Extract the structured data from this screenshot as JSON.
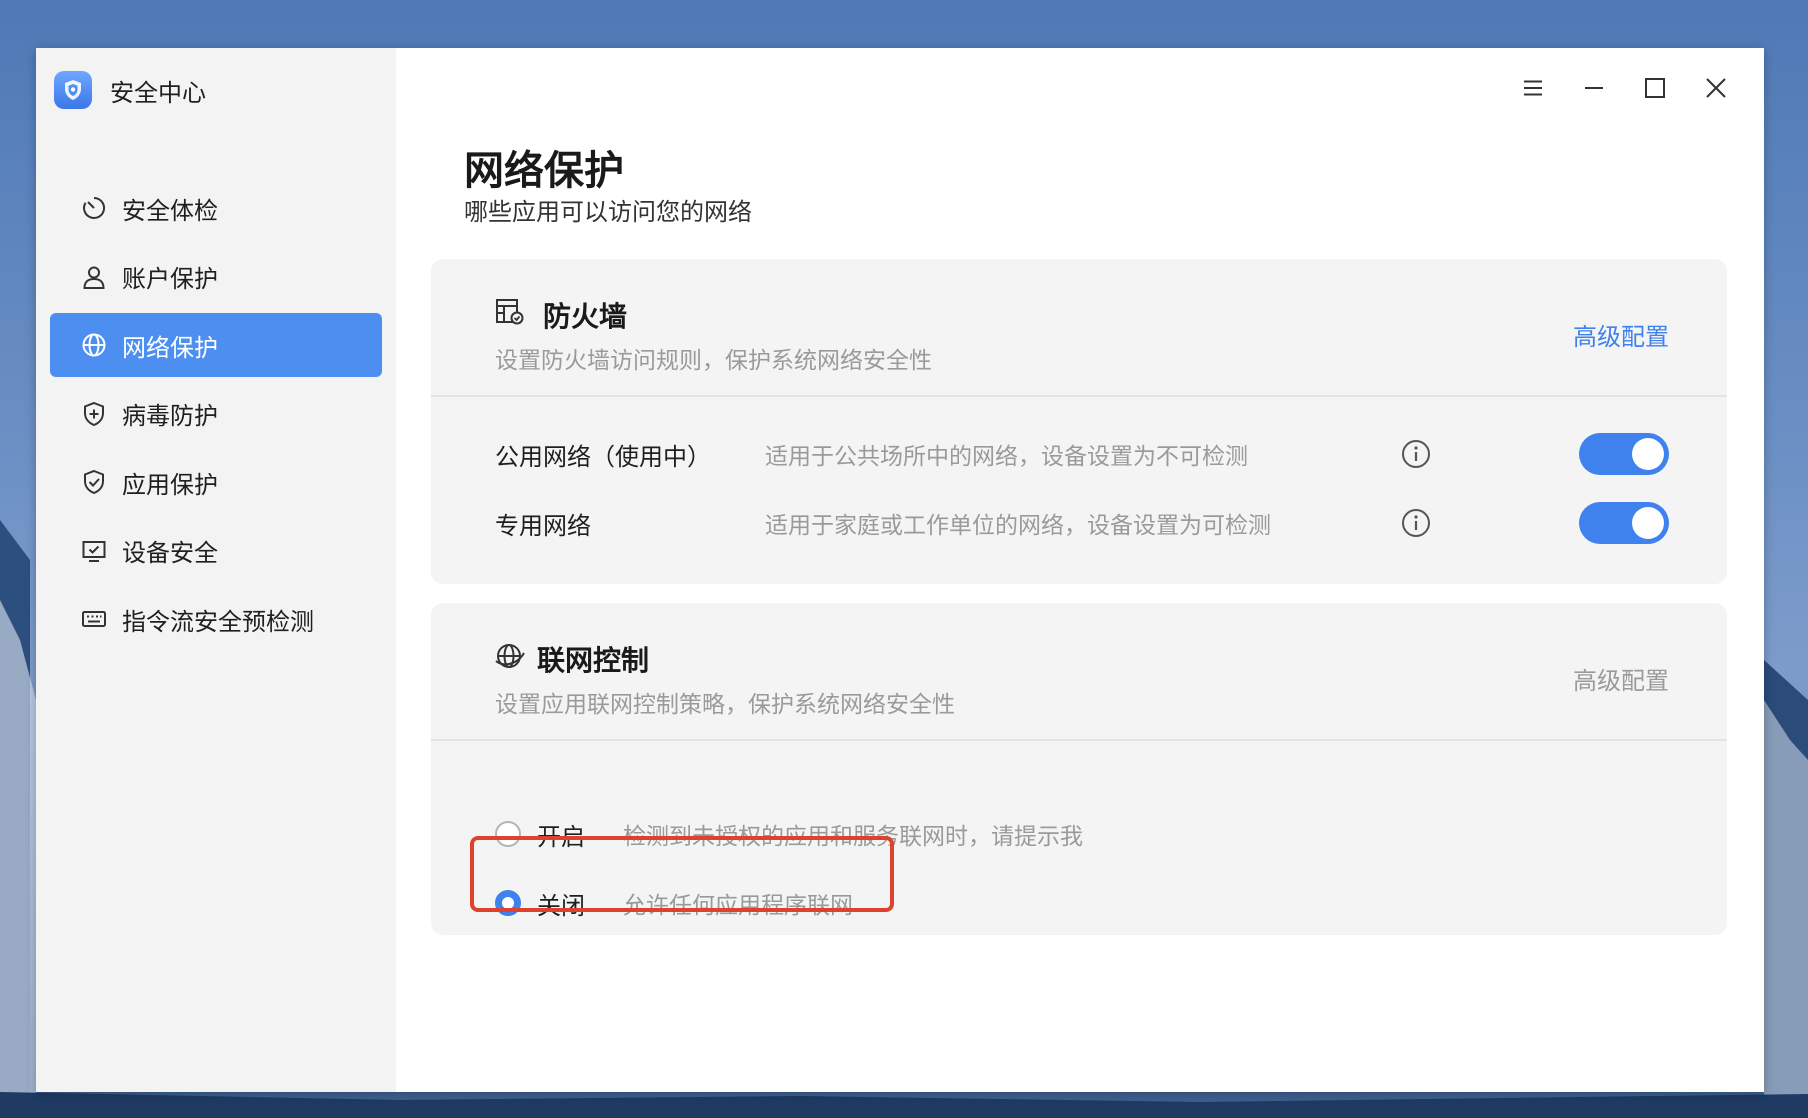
{
  "app": {
    "title": "安全中心"
  },
  "sidebar": {
    "items": [
      {
        "label": "安全体检",
        "icon": "scan-icon",
        "active": false
      },
      {
        "label": "账户保护",
        "icon": "user-icon",
        "active": false
      },
      {
        "label": "网络保护",
        "icon": "globe-icon",
        "active": true
      },
      {
        "label": "病毒防护",
        "icon": "shield-plus-icon",
        "active": false
      },
      {
        "label": "应用保护",
        "icon": "shield-check-icon",
        "active": false
      },
      {
        "label": "设备安全",
        "icon": "monitor-check-icon",
        "active": false
      },
      {
        "label": "指令流安全预检测",
        "icon": "keyboard-icon",
        "active": false
      }
    ]
  },
  "window_controls": [
    "menu-icon",
    "minimize-icon",
    "maximize-icon",
    "close-icon"
  ],
  "page": {
    "title": "网络保护",
    "subtitle": "哪些应用可以访问您的网络"
  },
  "firewall": {
    "title": "防火墙",
    "description": "设置防火墙访问规则，保护系统网络安全性",
    "advanced_label": "高级配置",
    "advanced_color": "#3f82ee",
    "networks": [
      {
        "label": "公用网络（使用中）",
        "description": "适用于公共场所中的网络，设备设置为不可检测",
        "enabled": true
      },
      {
        "label": "专用网络",
        "description": "适用于家庭或工作单位的网络，设备设置为可检测",
        "enabled": true
      }
    ]
  },
  "network_control": {
    "title": "联网控制",
    "description": "设置应用联网控制策略，保护系统网络安全性",
    "advanced_label": "高级配置",
    "advanced_color": "#9a9a9a",
    "options": [
      {
        "label": "开启",
        "description": "检测到未授权的应用和服务联网时，请提示我",
        "selected": false
      },
      {
        "label": "关闭",
        "description": "允许任何应用程序联网",
        "selected": true
      }
    ]
  },
  "colors": {
    "accent": "#3f82ee",
    "highlight": "#e0412c"
  }
}
